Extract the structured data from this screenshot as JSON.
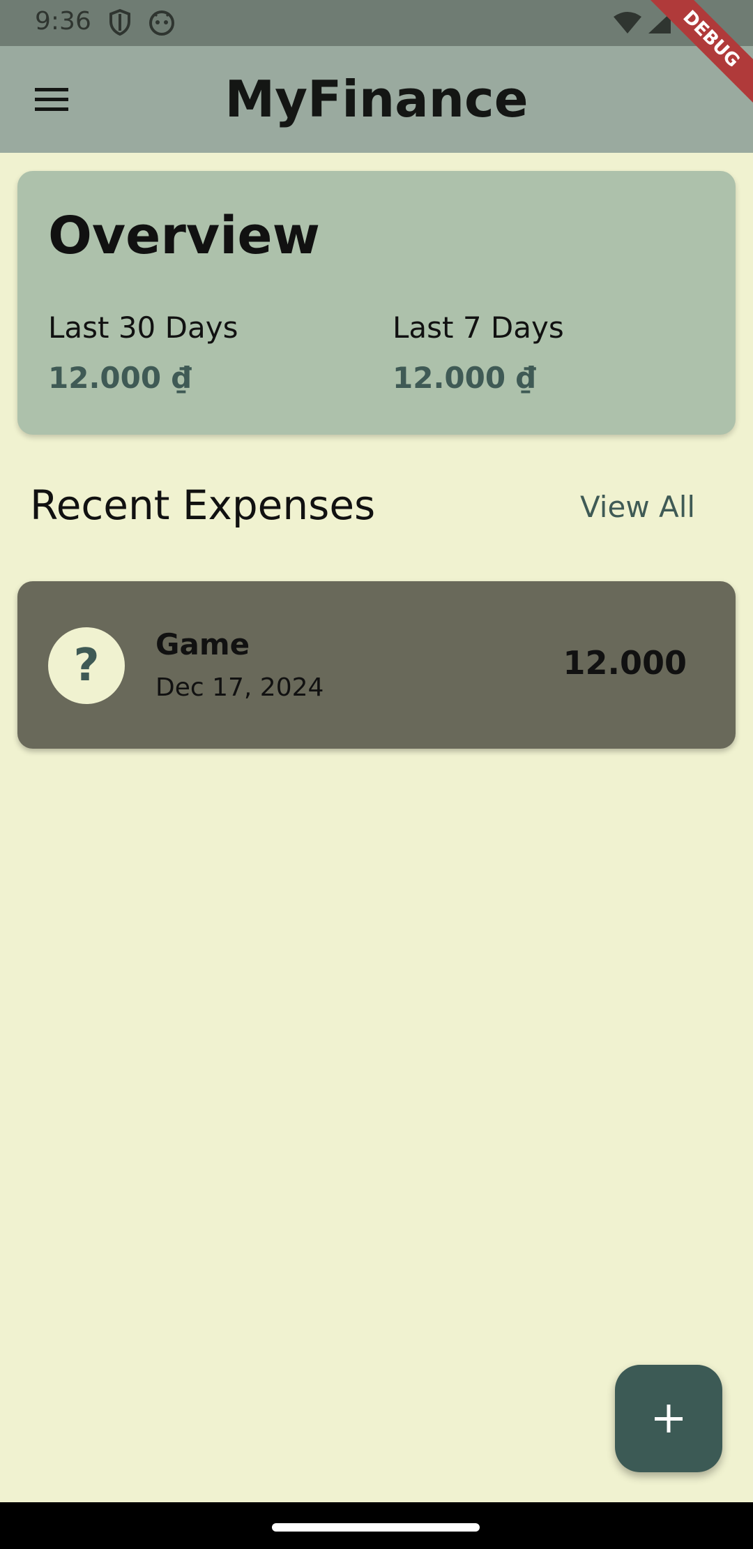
{
  "status_bar": {
    "time": "9:36"
  },
  "app_bar": {
    "title": "MyFinance",
    "debug_label": "DEBUG"
  },
  "overview": {
    "title": "Overview",
    "last_30_label": "Last 30 Days",
    "last_30_value": "12.000 ₫",
    "last_7_label": "Last 7 Days",
    "last_7_value": "12.000 ₫"
  },
  "recent": {
    "title": "Recent Expenses",
    "view_all_label": "View All",
    "items": [
      {
        "icon_glyph": "?",
        "name": "Game",
        "date": "Dec 17, 2024",
        "amount": "12.000"
      }
    ]
  },
  "fab": {
    "icon": "plus-icon",
    "color": "#3c5a55"
  },
  "colors": {
    "background": "#f0f2d0",
    "app_bar": "#9aaa9f",
    "overview_card": "#adc1ab",
    "expense_card": "#69695a",
    "accent": "#3f5a55"
  }
}
